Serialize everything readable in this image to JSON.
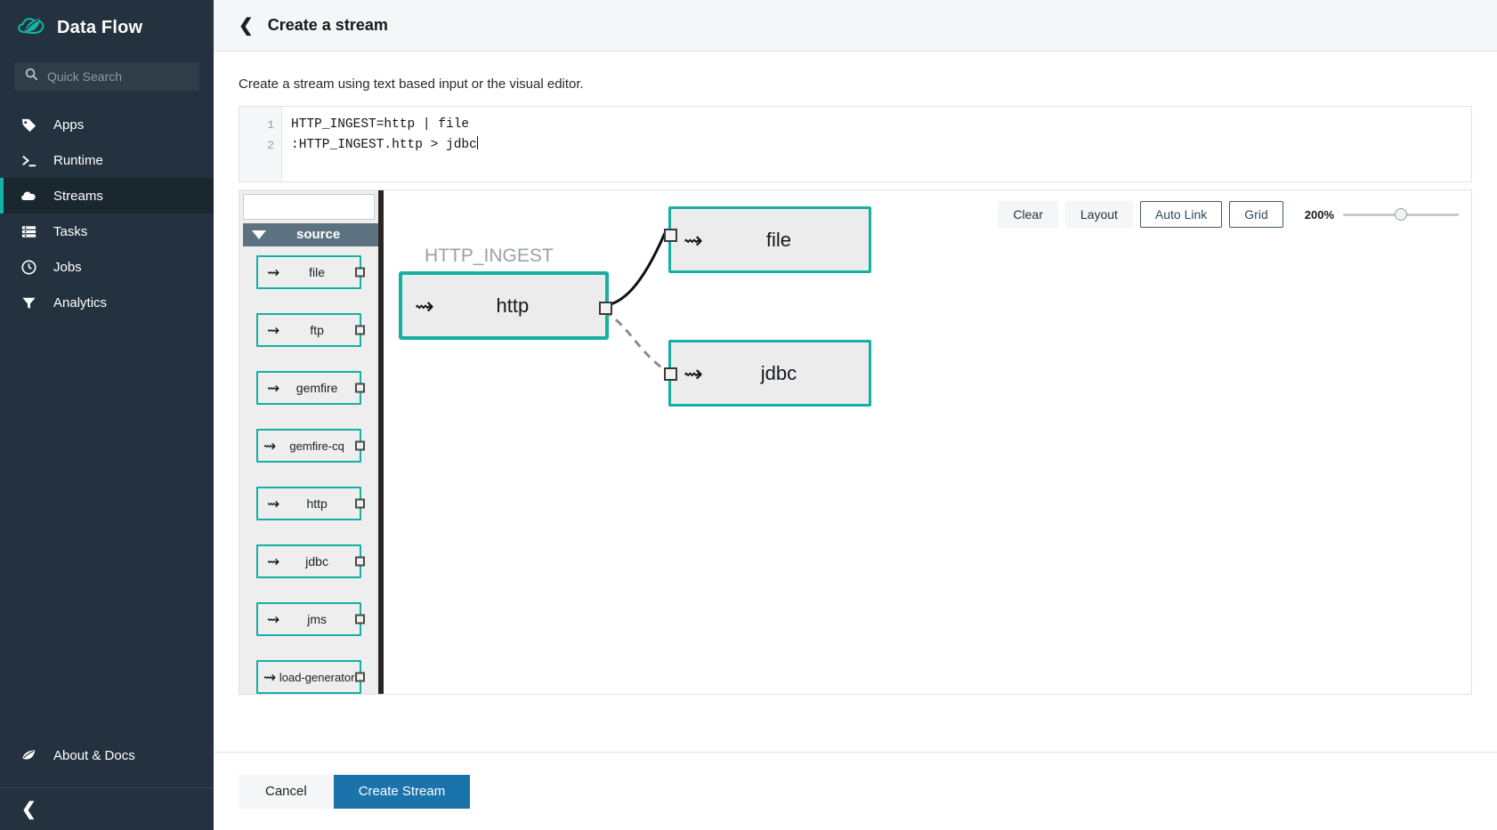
{
  "brand": {
    "title": "Data Flow",
    "logo_icon": "cloud-leaf-logo"
  },
  "search": {
    "placeholder": "Quick Search",
    "value": "",
    "icon": "search-icon"
  },
  "sidebar": {
    "items": [
      {
        "label": "Apps",
        "icon": "tag-icon",
        "active": false
      },
      {
        "label": "Runtime",
        "icon": "terminal-icon",
        "active": false
      },
      {
        "label": "Streams",
        "icon": "cloud-icon",
        "active": true
      },
      {
        "label": "Tasks",
        "icon": "list-icon",
        "active": false
      },
      {
        "label": "Jobs",
        "icon": "clock-icon",
        "active": false
      },
      {
        "label": "Analytics",
        "icon": "funnel-icon",
        "active": false
      }
    ],
    "about": {
      "label": "About & Docs",
      "icon": "leaf-icon"
    },
    "collapse": {
      "icon": "chevron-left-icon"
    },
    "accent_color": "#13b5a6",
    "bg_color": "#23323e"
  },
  "header": {
    "title": "Create a stream",
    "back_icon": "chevron-left-icon"
  },
  "intro": "Create a stream using text based input or the visual editor.",
  "editor": {
    "lines": [
      {
        "number": "1",
        "text": "HTTP_INGEST=http | file"
      },
      {
        "number": "2",
        "text": ":HTTP_INGEST.http > jdbc"
      }
    ]
  },
  "palette": {
    "search_value": "",
    "search_placeholder": "",
    "group_label": "source",
    "group_expanded": true,
    "items": [
      {
        "label": "file"
      },
      {
        "label": "ftp"
      },
      {
        "label": "gemfire"
      },
      {
        "label": "gemfire-cq"
      },
      {
        "label": "http"
      },
      {
        "label": "jdbc"
      },
      {
        "label": "jms"
      },
      {
        "label": "load-generator"
      }
    ]
  },
  "canvas": {
    "toolbar": [
      {
        "label": "Clear",
        "style": "plain"
      },
      {
        "label": "Layout",
        "style": "plain"
      },
      {
        "label": "Auto Link",
        "style": "outlined"
      },
      {
        "label": "Grid",
        "style": "outlined"
      }
    ],
    "zoom": {
      "level": "200%"
    },
    "stream_name": "HTTP_INGEST",
    "nodes": [
      {
        "id": "http",
        "label": "http",
        "selected": true
      },
      {
        "id": "file",
        "label": "file",
        "selected": false
      },
      {
        "id": "jdbc",
        "label": "jdbc",
        "selected": false
      }
    ],
    "links": [
      {
        "from": "http",
        "to": "file",
        "style": "solid"
      },
      {
        "from": "http",
        "to": "jdbc",
        "style": "dashed"
      }
    ]
  },
  "footer": {
    "cancel_label": "Cancel",
    "create_label": "Create Stream",
    "primary_color": "#1a73ab"
  }
}
